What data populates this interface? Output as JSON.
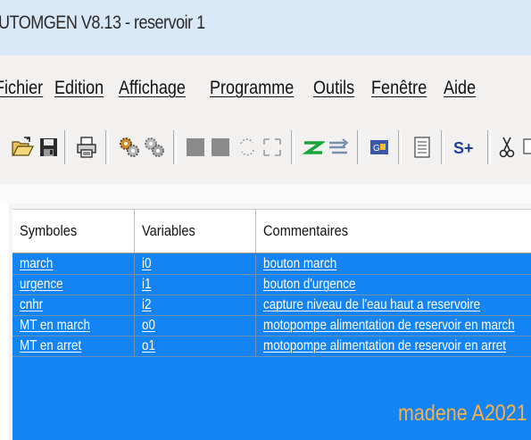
{
  "window": {
    "title": "UTOMGEN V8.13 - reservoir 1"
  },
  "menu": {
    "items": [
      "Fichier",
      "Edition",
      "Affichage",
      "Programme",
      "Outils",
      "Fenêtre",
      "Aide"
    ]
  },
  "toolbar": {
    "buttons": [
      "open-folder-icon",
      "save-icon",
      "print-icon",
      "compile-gear-icon",
      "compile-gear-disabled-icon",
      "stop-square-icon",
      "stop-square-2-icon",
      "rotate-icon",
      "expand-icon",
      "green-z-icon",
      "grafcet-icon",
      "run-connect-icon",
      "list-icon",
      "symbol-add-icon",
      "cut-icon"
    ],
    "symbol_add_label": "S+"
  },
  "table": {
    "columns": [
      "Symboles",
      "Variables",
      "Commentaires"
    ],
    "rows": [
      {
        "symbol": "march",
        "variable": "i0",
        "comment": "bouton march"
      },
      {
        "symbol": "urgence",
        "variable": "i1",
        "comment": "bouton d'urgence"
      },
      {
        "symbol": "cnhr",
        "variable": "i2",
        "comment": "capture niveau de l'eau haut a reservoire"
      },
      {
        "symbol": "MT en march",
        "variable": "o0",
        "comment": "motopompe alimentation de reservoir en march"
      },
      {
        "symbol": "MT en arret",
        "variable": "o1",
        "comment": "motopompe alimentation de reservoir en arret"
      }
    ]
  },
  "watermark": "madene A2021",
  "colors": {
    "selection": "#1484f4",
    "watermark": "#f5b24a",
    "titlebar": "#d9e8f6"
  }
}
